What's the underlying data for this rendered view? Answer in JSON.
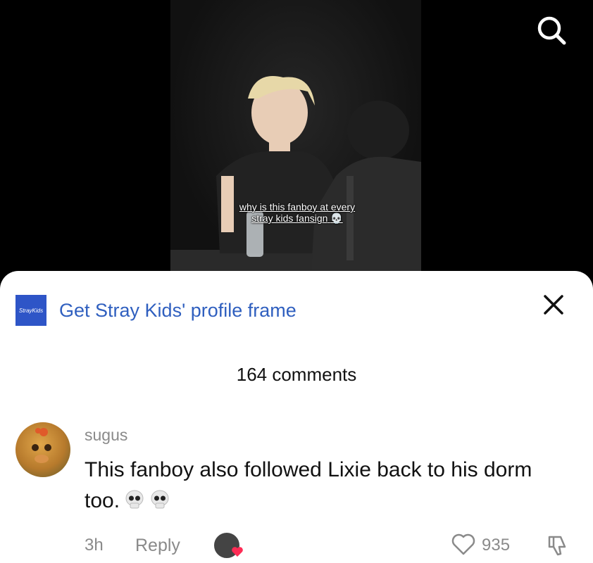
{
  "video": {
    "caption_line1": "why is this fanboy at every",
    "caption_line2": "stray kids fansign"
  },
  "banner": {
    "logo_text": "StrayKids",
    "text": "Get Stray Kids' profile frame"
  },
  "comments_header": {
    "count_label": "164 comments"
  },
  "comment": {
    "username": "sugus",
    "text": "This fanboy also followed Lixie back to his dorm too.",
    "time": "3h",
    "reply_label": "Reply",
    "like_count": "935"
  },
  "colors": {
    "link_blue": "#2f5fbf",
    "meta_gray": "#8a8a8a",
    "heart_red": "#fe2c55"
  },
  "icons": [
    "search-icon",
    "close-icon",
    "skull-emoji",
    "heart-icon",
    "dislike-icon"
  ]
}
